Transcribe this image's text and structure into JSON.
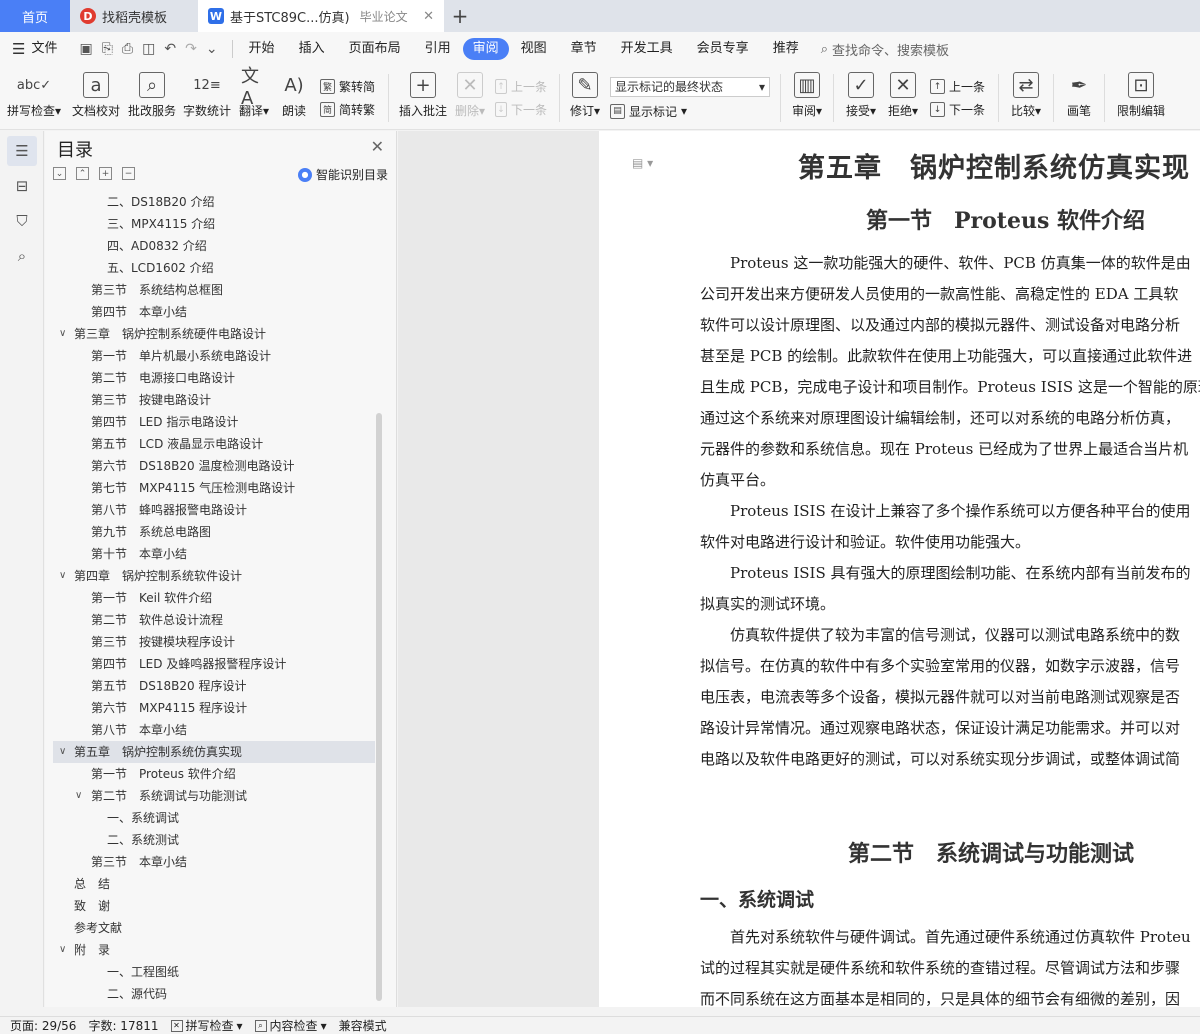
{
  "tabs": {
    "home": "首页",
    "template": "找稻壳模板",
    "doc": "基于STC89C...仿真)",
    "doc_suffix": "毕业论文"
  },
  "menu": {
    "file": "文件",
    "items": [
      "开始",
      "插入",
      "页面布局",
      "引用",
      "审阅",
      "视图",
      "章节",
      "开发工具",
      "会员专享",
      "推荐"
    ],
    "search": "查找命令、搜索模板"
  },
  "ribbon": {
    "spell": "拼写检查",
    "doc_check": "文档校对",
    "batch": "批改服务",
    "word_count": "字数统计",
    "translate": "翻译",
    "read": "朗读",
    "to_simplified": "繁转简",
    "to_traditional": "简转繁",
    "insert_comment": "插入批注",
    "delete": "删除",
    "prev": "上一条",
    "next": "下一条",
    "revise": "修订",
    "markup_state": "显示标记的最终状态",
    "show_markup": "显示标记",
    "review": "审阅",
    "accept": "接受",
    "reject": "拒绝",
    "prev2": "上一条",
    "next2": "下一条",
    "compare": "比较",
    "pen": "画笔",
    "restrict": "限制编辑"
  },
  "toc": {
    "title": "目录",
    "smart": "智能识别目录",
    "items": [
      {
        "t": "二、DS18B20 介绍",
        "lvl": 3
      },
      {
        "t": "三、MPX4115 介绍",
        "lvl": 3
      },
      {
        "t": "四、AD0832 介绍",
        "lvl": 3
      },
      {
        "t": "五、LCD1602 介绍",
        "lvl": 3
      },
      {
        "t": "第三节　系统结构总框图",
        "lvl": 2
      },
      {
        "t": "第四节　本章小结",
        "lvl": 2
      },
      {
        "t": "第三章　锅炉控制系统硬件电路设计",
        "lvl": 1,
        "chev": true
      },
      {
        "t": "第一节　单片机最小系统电路设计",
        "lvl": 2
      },
      {
        "t": "第二节　电源接口电路设计",
        "lvl": 2
      },
      {
        "t": "第三节　按键电路设计",
        "lvl": 2
      },
      {
        "t": "第四节　LED 指示电路设计",
        "lvl": 2
      },
      {
        "t": "第五节　LCD 液晶显示电路设计",
        "lvl": 2
      },
      {
        "t": "第六节　DS18B20 温度检测电路设计",
        "lvl": 2
      },
      {
        "t": "第七节　MXP4115 气压检测电路设计",
        "lvl": 2
      },
      {
        "t": "第八节　蜂鸣器报警电路设计",
        "lvl": 2
      },
      {
        "t": "第九节　系统总电路图",
        "lvl": 2
      },
      {
        "t": "第十节　本章小结",
        "lvl": 2
      },
      {
        "t": "第四章　锅炉控制系统软件设计",
        "lvl": 1,
        "chev": true
      },
      {
        "t": "第一节　Keil 软件介绍",
        "lvl": 2
      },
      {
        "t": "第二节　软件总设计流程",
        "lvl": 2
      },
      {
        "t": "第三节　按键模块程序设计",
        "lvl": 2
      },
      {
        "t": "第四节　LED 及蜂鸣器报警程序设计",
        "lvl": 2
      },
      {
        "t": "第五节　DS18B20 程序设计",
        "lvl": 2
      },
      {
        "t": "第六节　MXP4115 程序设计",
        "lvl": 2
      },
      {
        "t": "第八节　本章小结",
        "lvl": 2
      },
      {
        "t": "第五章　锅炉控制系统仿真实现",
        "lvl": 1,
        "chev": true,
        "sel": true
      },
      {
        "t": "第一节　Proteus 软件介绍",
        "lvl": 2
      },
      {
        "t": "第二节　系统调试与功能测试",
        "lvl": 2,
        "chev": true
      },
      {
        "t": "一、系统调试",
        "lvl": 3
      },
      {
        "t": "二、系统测试",
        "lvl": 3
      },
      {
        "t": "第三节　本章小结",
        "lvl": 2
      },
      {
        "t": "总　结",
        "lvl": 1
      },
      {
        "t": "致　谢",
        "lvl": 1
      },
      {
        "t": "参考文献",
        "lvl": 1
      },
      {
        "t": "附　录",
        "lvl": 1,
        "chev": true
      },
      {
        "t": "一、工程图纸",
        "lvl": 3
      },
      {
        "t": "二、源代码",
        "lvl": 3
      }
    ]
  },
  "doc": {
    "chapter": "第五章　锅炉控制系统仿真实现",
    "sec1": "第一节　Proteus 软件介绍",
    "p1": [
      "Proteus 这一款功能强大的硬件、软件、PCB 仿真集一体的软件是由",
      "公司开发出来方便研发人员使用的一款高性能、高稳定性的 EDA 工具软",
      "软件可以设计原理图、以及通过内部的模拟元器件、测试设备对电路分析",
      "甚至是 PCB 的绘制。此款软件在使用上功能强大，可以直接通过此软件进",
      "且生成 PCB，完成电子设计和项目制作。Proteus ISIS 这是一个智能的原理",
      "通过这个系统来对原理图设计编辑绘制，还可以对系统的电路分析仿真，",
      "元器件的参数和系统信息。现在 Proteus 已经成为了世界上最适合当片机",
      "仿真平台。"
    ],
    "p2": [
      "Proteus ISIS 在设计上兼容了多个操作系统可以方便各种平台的使用",
      "软件对电路进行设计和验证。软件使用功能强大。"
    ],
    "p3": [
      "Proteus ISIS 具有强大的原理图绘制功能、在系统内部有当前发布的",
      "拟真实的测试环境。"
    ],
    "p4": [
      "仿真软件提供了较为丰富的信号测试，仪器可以测试电路系统中的数",
      "拟信号。在仿真的软件中有多个实验室常用的仪器，如数字示波器，信号",
      "电压表，电流表等多个设备，模拟元器件就可以对当前电路测试观察是否",
      "路设计异常情况。通过观察电路状态，保证设计满足功能需求。并可以对",
      "电路以及软件电路更好的测试，可以对系统实现分步调试，或整体调试简"
    ],
    "sec2": "第二节　系统调试与功能测试",
    "sub1": "一、系统调试",
    "p5": [
      "首先对系统软件与硬件调试。首先通过硬件系统通过仿真软件 Proteu",
      "试的过程其实就是硬件系统和软件系统的查错过程。尽管调试方法和步骤",
      "而不同系统在这方面基本是相同的，只是具体的细节会有细微的差别，因"
    ]
  },
  "status": {
    "page": "页面: 29/56",
    "words": "字数: 17811",
    "spell": "拼写检查",
    "content": "内容检查",
    "compat": "兼容模式"
  }
}
